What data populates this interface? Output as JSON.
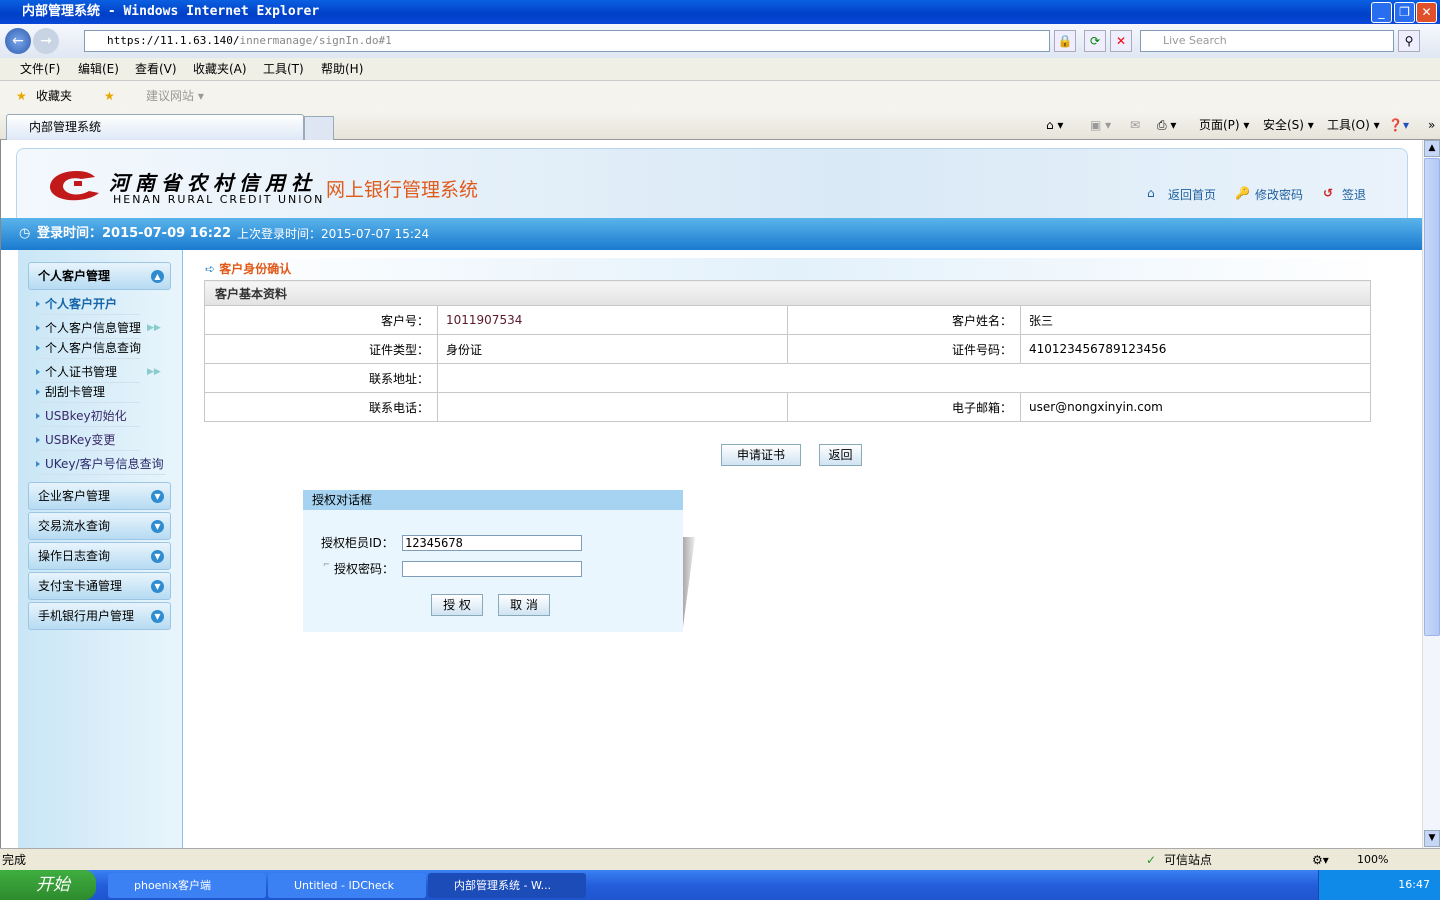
{
  "window": {
    "title": "内部管理系统 - Windows Internet Explorer",
    "min": "_",
    "max": "❐",
    "close": "✕"
  },
  "browser": {
    "url_host": "https://11.1.63.140/",
    "url_path": "innermanage/signIn.do#1",
    "search_placeholder": "Live Search",
    "menu": [
      "文件(F)",
      "编辑(E)",
      "查看(V)",
      "收藏夹(A)",
      "工具(T)",
      "帮助(H)"
    ],
    "favorites_label": "收藏夹",
    "suggested_sites": "建议网站 ▾",
    "tab_title": "内部管理系统",
    "cmd": [
      "页面(P) ▾",
      "安全(S) ▾",
      "工具(O) ▾"
    ]
  },
  "header": {
    "logo_cn": "河南省农村信用社",
    "logo_en": "HENAN  RURAL CREDIT  UNION",
    "system_title": "网上银行管理系统",
    "links": [
      "返回首页",
      "修改密码",
      "签退"
    ],
    "login_time": "登录时间：2015-07-09 16:22",
    "last_login": "上次登录时间：2015-07-07 15:24"
  },
  "sidebar": {
    "groups": [
      {
        "label": "个人客户管理",
        "expanded": true
      },
      {
        "label": "企业客户管理"
      },
      {
        "label": "交易流水查询"
      },
      {
        "label": "操作日志查询"
      },
      {
        "label": "支付宝卡通管理"
      },
      {
        "label": "手机银行用户管理"
      }
    ],
    "items": [
      "个人客户开户",
      "个人客户信息管理",
      "个人客户信息查询",
      "个人证书管理",
      "刮刮卡管理",
      "USBkey初始化",
      "USBKey变更",
      "UKey/客户号信息查询"
    ]
  },
  "main": {
    "breadcrumb": "客户身份确认",
    "section_title": "客户基本资料",
    "fields": {
      "cust_no_label": "客户号：",
      "cust_no": "1011907534",
      "name_label": "客户姓名：",
      "name": "张三",
      "id_type_label": "证件类型：",
      "id_type": "身份证",
      "id_no_label": "证件号码：",
      "id_no": "410123456789123456",
      "address_label": "联系地址：",
      "address": "",
      "phone_label": "联系电话：",
      "phone": "",
      "email_label": "电子邮箱：",
      "email": "user@nongxinyin.com"
    },
    "apply_button": "申请证书",
    "back_button": "返回"
  },
  "dialog": {
    "title": "授权对话框",
    "teller_label": "授权柜员ID：",
    "teller_id": "12345678",
    "password_label": "授权密码：",
    "password": "",
    "ok": "授 权",
    "cancel": "取 消"
  },
  "status": {
    "text": "完成",
    "zone": "可信站点",
    "zoom": "100%"
  },
  "taskbar": {
    "start": "开始",
    "tasks": [
      "phoenix客户端",
      "Untitled - IDCheck",
      "内部管理系统 - W..."
    ],
    "clock": "16:47"
  }
}
